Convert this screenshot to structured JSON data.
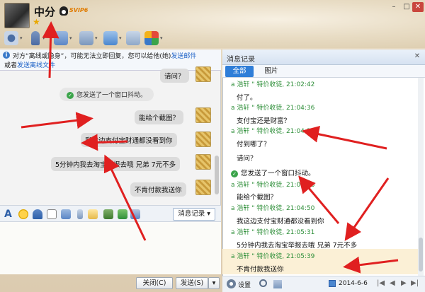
{
  "header": {
    "contact_name": "中分",
    "vip_badge": "SVIP6",
    "window_controls": {
      "minimize": "–",
      "maximize": "□",
      "close": "✕"
    }
  },
  "info_bar": {
    "line1_prefix": "对方“离线或隐身”，可能无法立即回复，您可以给他(她)",
    "line1_link": "发送邮件",
    "line2_prefix": "或者",
    "line2_link": "发送离线文件"
  },
  "chat": {
    "messages": [
      {
        "type": "bubble",
        "text": "请问？"
      },
      {
        "type": "system",
        "text": "您发送了一个窗口抖动。"
      },
      {
        "type": "bubble",
        "text": "能给个截图？"
      },
      {
        "type": "bubble",
        "text": "我这边支付宝财通都没看到你"
      },
      {
        "type": "bubble",
        "text": "5分钟内我去淘宝举报去哦 兄弟 7元不多"
      },
      {
        "type": "bubble",
        "text": "不肯付款我送你"
      }
    ]
  },
  "input_toolbar": {
    "message_record_label": "消息记录"
  },
  "buttons": {
    "close": "关闭(C)",
    "send": "发送(S)",
    "send_dropdown": "▾"
  },
  "history_panel": {
    "title": "消息记录",
    "close": "✕",
    "tabs": [
      {
        "label": "全部",
        "active": true
      },
      {
        "label": "图片",
        "active": false
      }
    ],
    "records": [
      {
        "header": "",
        "text": "付了。"
      },
      {
        "header": "a      浩轩  \" 特价收徒, 21:04:36",
        "text": "支付宝还是财富？"
      },
      {
        "header": "a      浩轩  \" 特价收徒, 21:04:38",
        "text": "付到哪了？"
      },
      {
        "header": "",
        "text": "请问？"
      },
      {
        "header": "",
        "text": "您发送了一个窗口抖动。",
        "system": true
      },
      {
        "header": "a      浩轩  \" 特价收徒, 21:04:46",
        "text": "能给个截图？"
      },
      {
        "header": "a      浩轩  \" 特价收徒, 21:04:50",
        "text": "我这边支付宝财通都没看到你"
      },
      {
        "header": "a      浩轩  \" 特价收徒, 21:05:31",
        "text": "5分钟内我去淘宝举报去哦 兄弟 7元不多"
      },
      {
        "header": "a      浩轩  \" 特价收徒, 21:05:39",
        "text": "不肯付款我送你"
      }
    ],
    "top_record_header": "a      浩轩  \" 特价收徒, 21:02:42",
    "bottom_bar": {
      "settings": "设置",
      "date": "2014-6-6"
    }
  },
  "colors": {
    "accent": "#2f7ed8",
    "arrow": "#e02020",
    "record_header": "#2f8f3a"
  }
}
